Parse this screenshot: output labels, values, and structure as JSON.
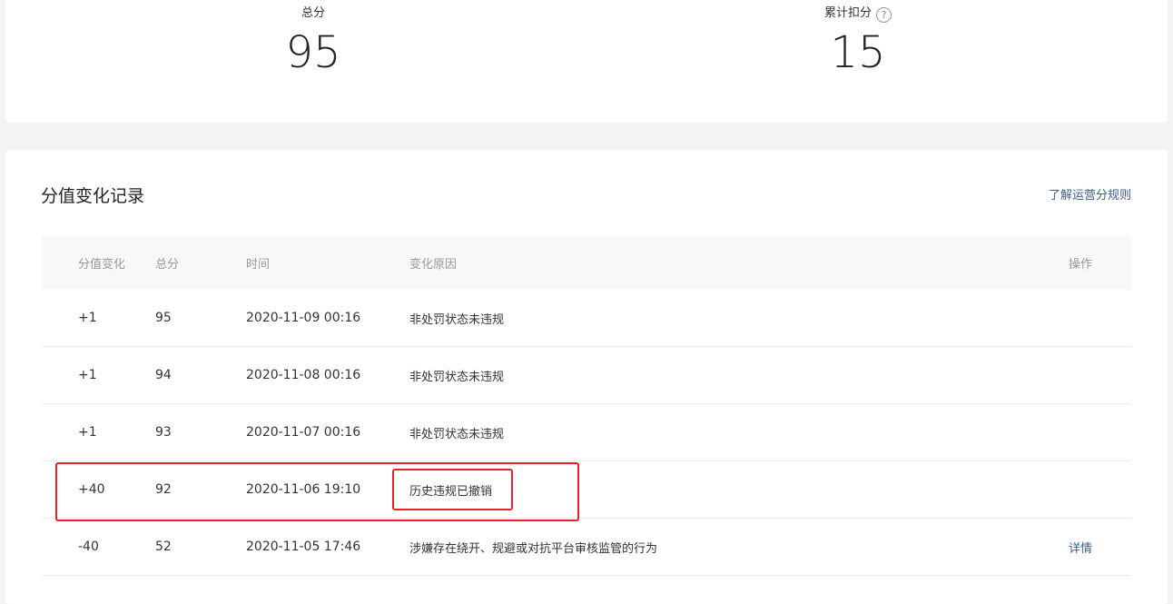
{
  "summary": {
    "total_label": "总分",
    "total_value": "95",
    "deduction_label": "累计扣分",
    "deduction_value": "15",
    "help_icon": "question-circle-icon"
  },
  "records": {
    "title": "分值变化记录",
    "rules_link": "了解运营分规则",
    "columns": {
      "change": "分值变化",
      "total": "总分",
      "time": "时间",
      "reason": "变化原因",
      "action": "操作"
    },
    "rows": [
      {
        "change": "+1",
        "total": "95",
        "time": "2020-11-09 00:16",
        "reason": "非处罚状态未违规",
        "action": ""
      },
      {
        "change": "+1",
        "total": "94",
        "time": "2020-11-08 00:16",
        "reason": "非处罚状态未违规",
        "action": ""
      },
      {
        "change": "+1",
        "total": "93",
        "time": "2020-11-07 00:16",
        "reason": "非处罚状态未违规",
        "action": ""
      },
      {
        "change": "+40",
        "total": "92",
        "time": "2020-11-06 19:10",
        "reason": "历史违规已撤销",
        "action": ""
      },
      {
        "change": "-40",
        "total": "52",
        "time": "2020-11-05 17:46",
        "reason": "涉嫌存在绕开、规避或对抗平台审核监管的行为",
        "action": "详情"
      }
    ]
  },
  "colors": {
    "link": "#3e5c89",
    "highlight": "#e8212a"
  }
}
